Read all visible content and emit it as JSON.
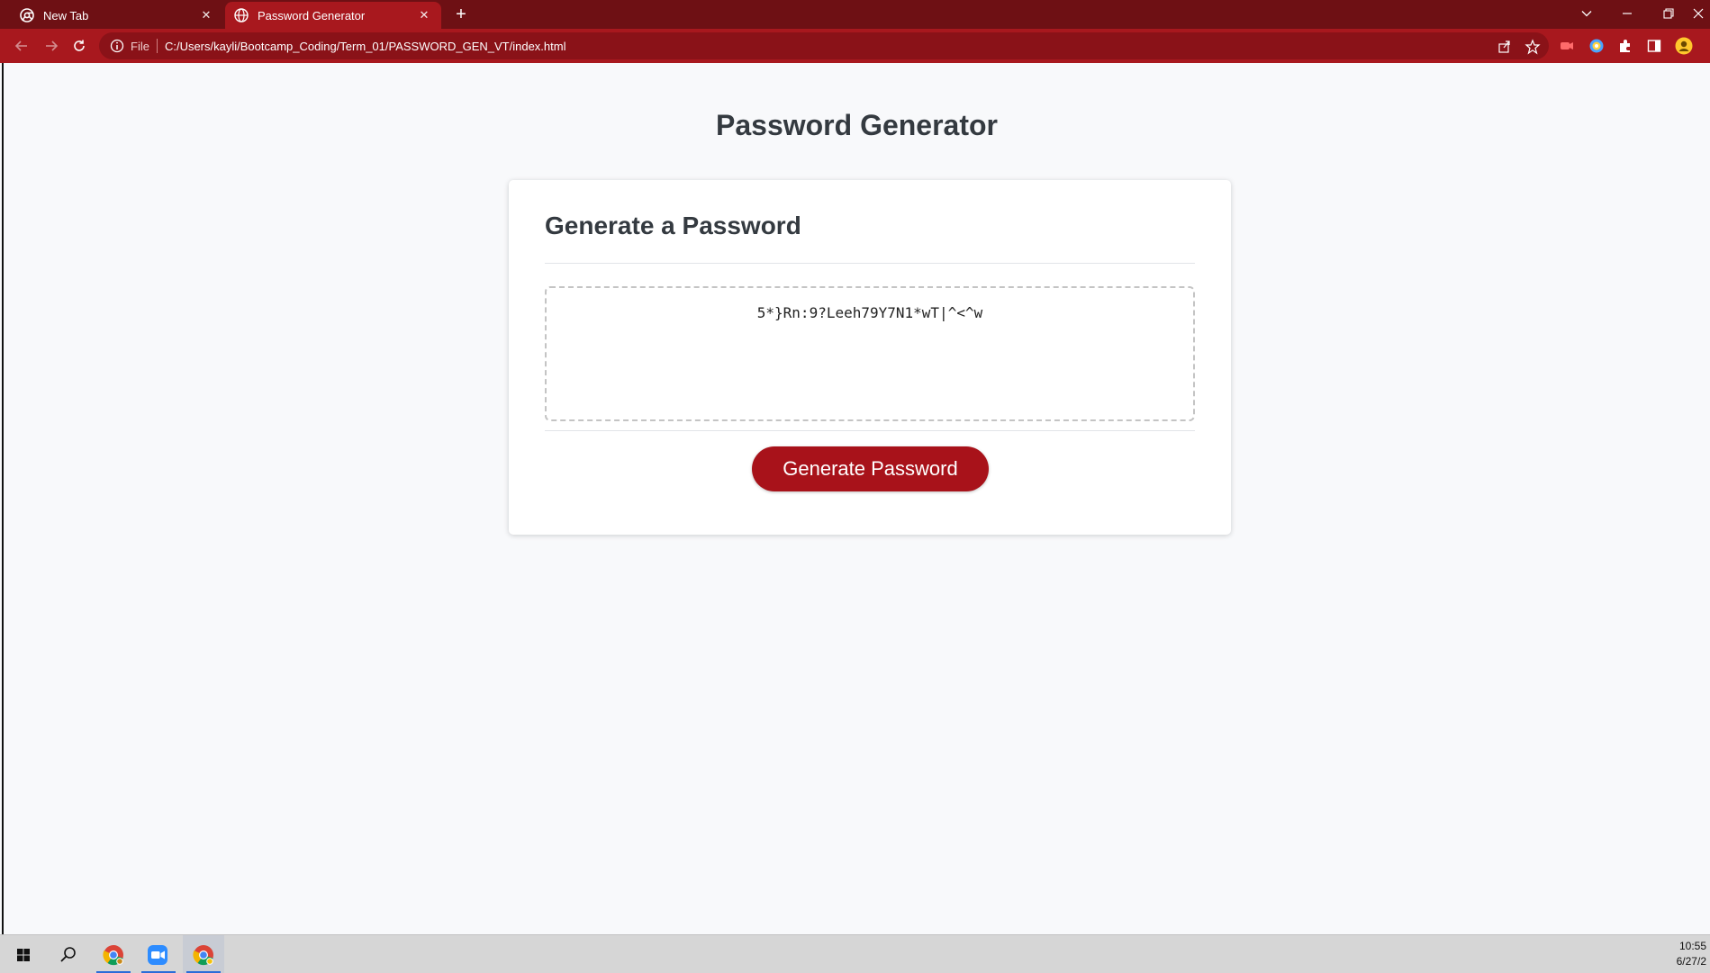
{
  "browser": {
    "tabs": [
      {
        "title": "New Tab",
        "active": false
      },
      {
        "title": "Password Generator",
        "active": true
      }
    ],
    "new_tab_glyph": "+",
    "close_glyph": "✕",
    "address": {
      "scheme_label": "File",
      "url": "C:/Users/kayli/Bootcamp_Coding/Term_01/PASSWORD_GEN_VT/index.html"
    },
    "colors": {
      "tabbar": "#6e1014",
      "toolbar": "#a8181e"
    }
  },
  "page": {
    "title": "Password Generator",
    "card": {
      "heading": "Generate a Password",
      "password_value": "5*}Rn:9?Leeh79Y7N1*wT|^<^w",
      "button_label": "Generate Password"
    },
    "accent_color": "#a8121a"
  },
  "taskbar": {
    "icons": [
      "windows-start-icon",
      "search-icon",
      "chrome-icon",
      "zoom-icon",
      "chrome-icon"
    ],
    "clock_time": "10:55",
    "clock_date": "6/27/2"
  }
}
